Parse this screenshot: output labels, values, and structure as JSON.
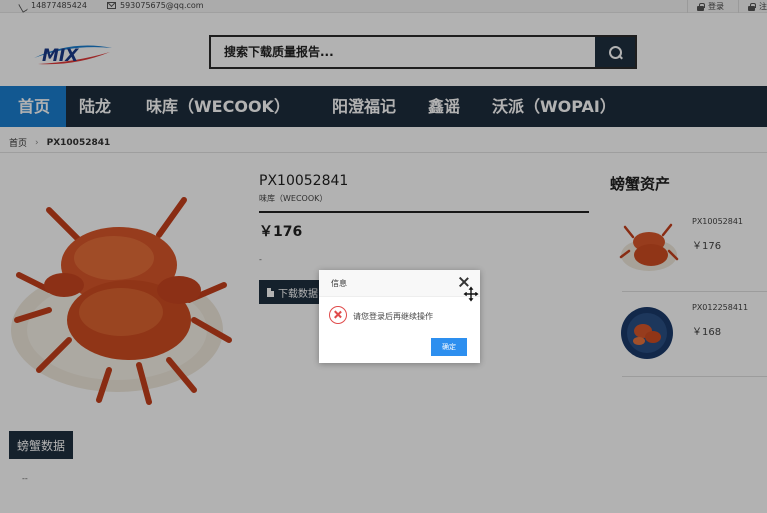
{
  "topbar": {
    "phone": "14877485424",
    "email": "593075675@qq.com",
    "login": "登录",
    "register": "注"
  },
  "header": {
    "logo_text": "MIX",
    "search_placeholder": "搜索下载质量报告..."
  },
  "nav": {
    "items": [
      {
        "label": "首页",
        "active": true
      },
      {
        "label": "陆龙"
      },
      {
        "label": "味库（WECOOK）"
      },
      {
        "label": "阳澄福记"
      },
      {
        "label": "鑫谣"
      },
      {
        "label": "沃派（WOPAI）"
      }
    ]
  },
  "breadcrumb": {
    "home": "首页",
    "separator": "›",
    "current": "PX10052841"
  },
  "product": {
    "title": "PX10052841",
    "brand": "味库（WECOOK）",
    "price": "￥176",
    "dash": "-",
    "download_label": "下载数据",
    "tab_label": "螃蟹数据",
    "tab_dash": "--"
  },
  "sidebar": {
    "title": "螃蟹资产",
    "items": [
      {
        "name": "PX10052841",
        "price": "￥176"
      },
      {
        "name": "PX012258411",
        "price": "￥168"
      }
    ]
  },
  "dialog": {
    "title": "信息",
    "message": "请您登录后再继续操作",
    "ok_label": "确定"
  },
  "colors": {
    "nav_bg": "#1e2d3d",
    "nav_active": "#1b7fd0",
    "dialog_button": "#2d8fef",
    "error": "#e04b4b"
  }
}
